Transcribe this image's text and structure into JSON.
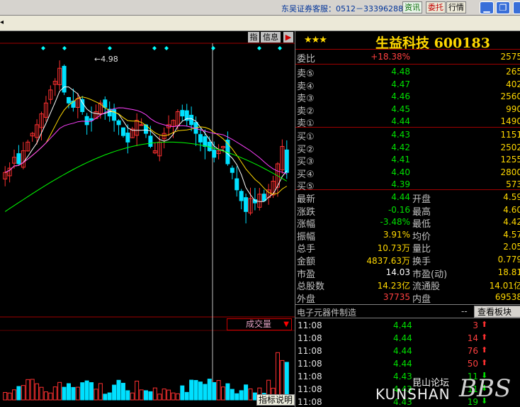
{
  "titlebar": {
    "service_text": "东吴证券客服：0512－33396288",
    "btn_news": "资讯",
    "btn_order": "委托",
    "btn_quote": "行情",
    "min_icon": "minimize-icon",
    "restore_icon": "restore-icon",
    "close_icon": "close-icon"
  },
  "chart": {
    "indicator_btn": "指",
    "info_label": "信息",
    "flag_icon": "flag-icon",
    "price_annotation": "4.98",
    "volume_selector": "成交量",
    "indicator_help": "指标说明"
  },
  "quote": {
    "stars": "★★★",
    "title": "生益科技 600183",
    "commission_ratio": {
      "label": "委比",
      "value": "+18.38%",
      "diff": "2575"
    },
    "asks": [
      {
        "label": "卖⑤",
        "price": "4.48",
        "vol": "265"
      },
      {
        "label": "卖④",
        "price": "4.47",
        "vol": "402"
      },
      {
        "label": "卖③",
        "price": "4.46",
        "vol": "2560"
      },
      {
        "label": "卖②",
        "price": "4.45",
        "vol": "990"
      },
      {
        "label": "卖①",
        "price": "4.44",
        "vol": "1490"
      }
    ],
    "bids": [
      {
        "label": "买①",
        "price": "4.43",
        "vol": "1151"
      },
      {
        "label": "买②",
        "price": "4.42",
        "vol": "2502"
      },
      {
        "label": "买③",
        "price": "4.41",
        "vol": "1255"
      },
      {
        "label": "买④",
        "price": "4.40",
        "vol": "2800"
      },
      {
        "label": "买⑤",
        "price": "4.39",
        "vol": "573"
      }
    ],
    "stats": [
      {
        "l1": "最新",
        "v1": "4.44",
        "c1": "green",
        "l2": "开盘",
        "v2": "4.59",
        "c2": "red"
      },
      {
        "l1": "涨跌",
        "v1": "-0.16",
        "c1": "green",
        "l2": "最高",
        "v2": "4.60",
        "c2": "white"
      },
      {
        "l1": "涨幅",
        "v1": "-3.48%",
        "c1": "green",
        "l2": "最低",
        "v2": "4.42",
        "c2": "green"
      },
      {
        "l1": "振幅",
        "v1": "3.91%",
        "c1": "yellow",
        "l2": "均价",
        "v2": "4.57",
        "c2": "green"
      },
      {
        "l1": "总手",
        "v1": "10.73万",
        "c1": "yellow",
        "l2": "量比",
        "v2": "2.05",
        "c2": "red"
      },
      {
        "l1": "金额",
        "v1": "4837.63万",
        "c1": "yellow",
        "l2": "换手",
        "v2": "0.779",
        "c2": "yellow"
      },
      {
        "l1": "市盈",
        "v1": "14.03",
        "c1": "white",
        "l2": "市盈(动)",
        "v2": "18.81",
        "c2": "white"
      },
      {
        "l1": "总股数",
        "v1": "14.23亿",
        "c1": "yellow",
        "l2": "流通股",
        "v2": "14.01亿",
        "c2": "yellow"
      },
      {
        "l1": "外盘",
        "v1": "37735",
        "c1": "red",
        "l2": "内盘",
        "v2": "69538",
        "c2": "green"
      }
    ],
    "industry": "电子元器件制造",
    "industry_dash": "--",
    "sector_btn": "查看板块股",
    "ticks": [
      {
        "time": "11:08",
        "price": "4.44",
        "vol": "3",
        "dir": "up"
      },
      {
        "time": "11:08",
        "price": "4.44",
        "vol": "14",
        "dir": "up"
      },
      {
        "time": "11:08",
        "price": "4.44",
        "vol": "76",
        "dir": "up"
      },
      {
        "time": "11:08",
        "price": "4.44",
        "vol": "50",
        "dir": "up"
      },
      {
        "time": "11:08",
        "price": "4.43",
        "vol": "11",
        "dir": "down"
      },
      {
        "time": "11:08",
        "price": "4.43",
        "vol": "11",
        "dir": "down"
      },
      {
        "time": "11:08",
        "price": "4.43",
        "vol": "19",
        "dir": "down"
      }
    ]
  },
  "watermark": {
    "top": "昆山论坛",
    "bottom": "KUNSHAN",
    "bbs": "BBS"
  },
  "colors": {
    "up": "#ff3030",
    "down": "#00e0ff",
    "ma5": "#ffffff",
    "ma10": "#ffd800",
    "ma20": "#ff40ff",
    "ma60": "#00ff00"
  }
}
